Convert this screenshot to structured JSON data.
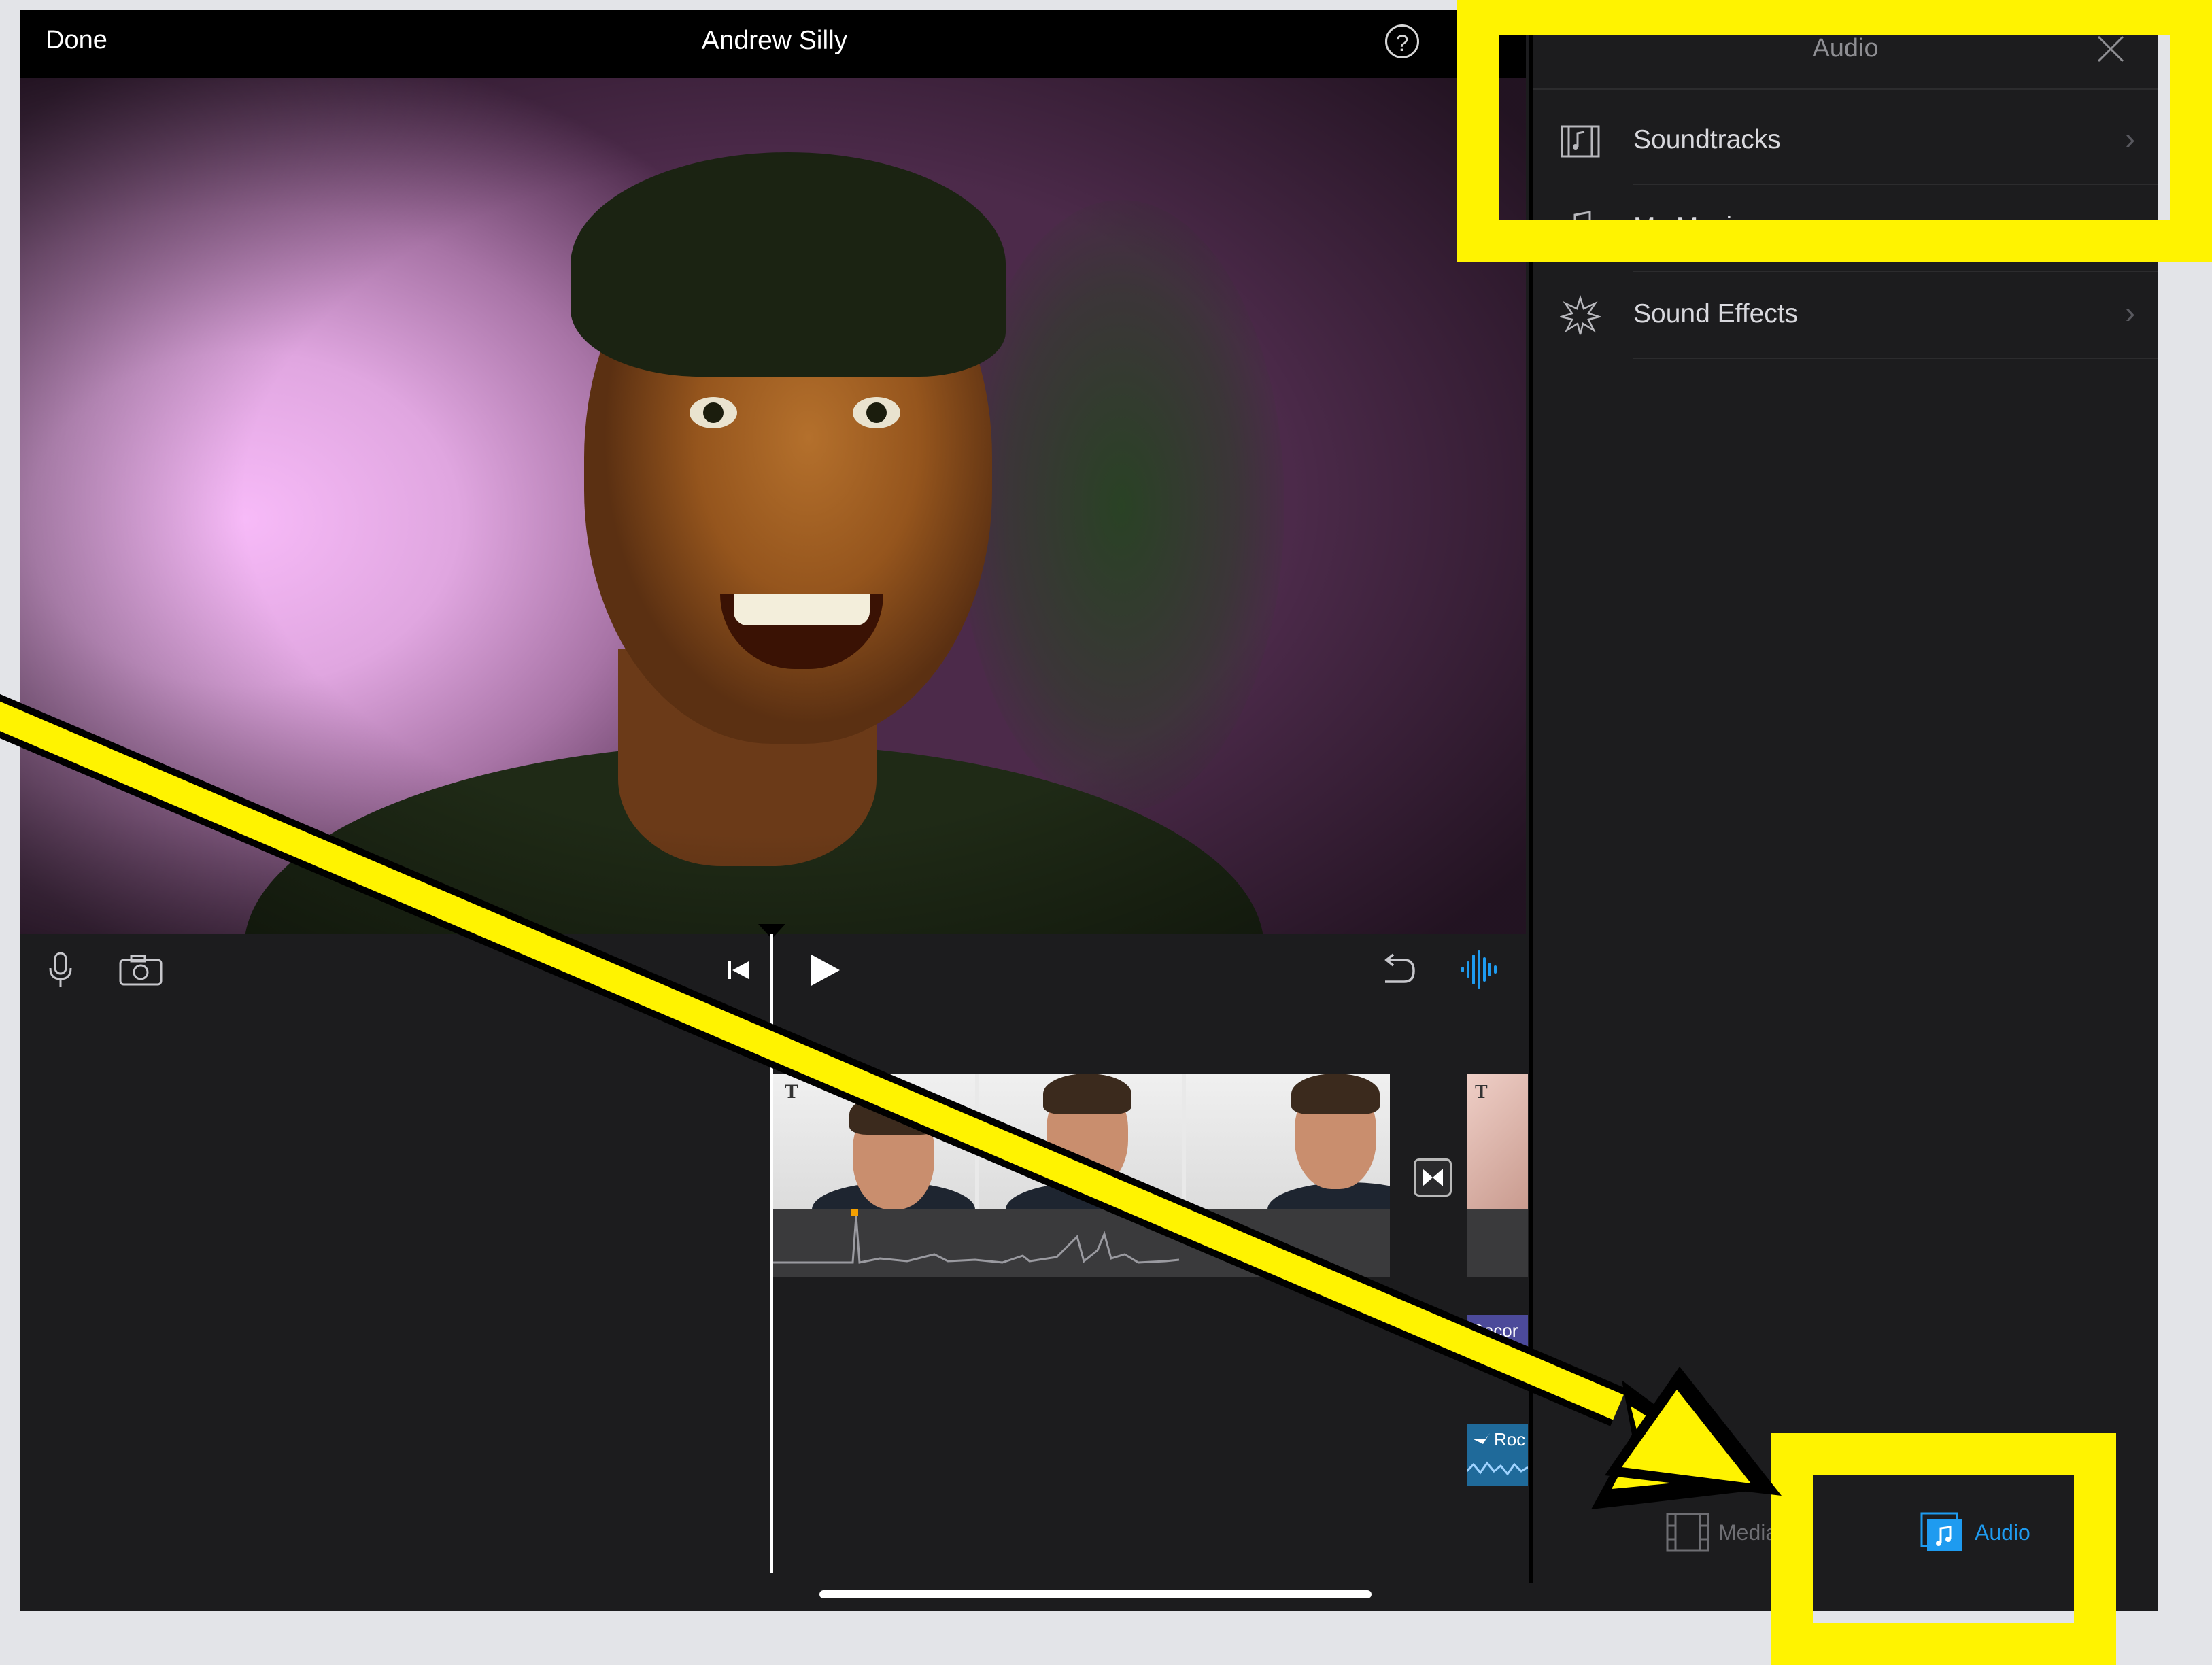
{
  "topbar": {
    "done_label": "Done",
    "project_title": "Andrew Silly",
    "help_label": "?"
  },
  "toolbar": {
    "microphone_icon": "microphone-icon",
    "camera_icon": "camera-icon",
    "skip_back_icon": "skip-to-start-icon",
    "play_icon": "play-icon",
    "undo_icon": "undo-icon",
    "audio_waveform_icon": "audio-waveform-icon"
  },
  "timeline": {
    "record_tag": "Recor",
    "rock_tag": "Roc",
    "title_marker": "T"
  },
  "panel": {
    "title": "Audio",
    "items": [
      {
        "label": "Soundtracks",
        "icon": "film-music-icon"
      },
      {
        "label": "My Music",
        "icon": "music-note-icon"
      },
      {
        "label": "Sound Effects",
        "icon": "starburst-icon"
      }
    ],
    "tabs": [
      {
        "label": "Media",
        "icon": "film-strip-icon",
        "selected": false
      },
      {
        "label": "Audio",
        "icon": "music-square-icon",
        "selected": true
      }
    ]
  },
  "colors": {
    "annotation_yellow": "#fff300",
    "accent_blue": "#1e9bf0",
    "panel_bg": "#1c1c1e"
  }
}
